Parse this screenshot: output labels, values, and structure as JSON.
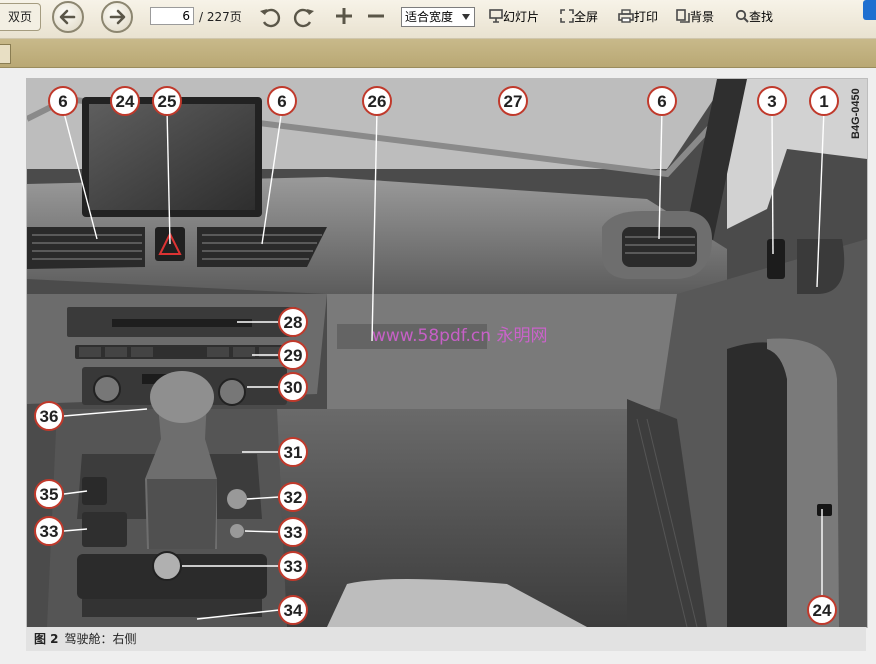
{
  "toolbar": {
    "left_label": "双页",
    "page_current": "6",
    "page_total": "/ 227页",
    "zoom_value": "适合宽度",
    "slideshow": "幻灯片",
    "fullscreen": "全屏",
    "print": "打印",
    "background": "背景",
    "find": "查找"
  },
  "figure": {
    "code": "B4G-0450",
    "watermark": "www.58pdf.cn 永明网",
    "caption_num": "图 2",
    "caption_text": "驾驶舱：右侧",
    "callouts": {
      "c6a": "6",
      "c24": "24",
      "c25": "25",
      "c6b": "6",
      "c26": "26",
      "c27": "27",
      "c6c": "6",
      "c3": "3",
      "c1": "1",
      "c28": "28",
      "c29": "29",
      "c30": "30",
      "c36": "36",
      "c31": "31",
      "c35": "35",
      "c32": "32",
      "c33a": "33",
      "c33b": "33",
      "c33c": "33",
      "c34": "34",
      "c24b": "24"
    }
  }
}
